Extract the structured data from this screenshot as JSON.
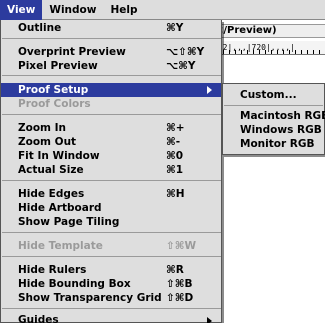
{
  "menubar": {
    "items": [
      {
        "label": "View",
        "active": true
      },
      {
        "label": "Window",
        "active": false
      },
      {
        "label": "Help",
        "active": false
      }
    ]
  },
  "document": {
    "title_fragment": "</Preview)",
    "ruler_text": "|52|,,,|720|,,,,|"
  },
  "view_menu": {
    "items": [
      {
        "label": "Outline",
        "shortcut": "⌘Y"
      },
      {
        "label": "Overprint Preview",
        "shortcut": "⌥⇧⌘Y"
      },
      {
        "label": "Pixel Preview",
        "shortcut": "⌥⌘Y"
      },
      {
        "label": "Proof Setup"
      },
      {
        "label": "Proof Colors"
      },
      {
        "label": "Zoom In",
        "shortcut": "⌘+"
      },
      {
        "label": "Zoom Out",
        "shortcut": "⌘-"
      },
      {
        "label": "Fit In Window",
        "shortcut": "⌘0"
      },
      {
        "label": "Actual Size",
        "shortcut": "⌘1"
      },
      {
        "label": "Hide Edges",
        "shortcut": "⌘H"
      },
      {
        "label": "Hide Artboard"
      },
      {
        "label": "Show Page Tiling"
      },
      {
        "label": "Hide Template",
        "shortcut": "⇧⌘W"
      },
      {
        "label": "Hide Rulers",
        "shortcut": "⌘R"
      },
      {
        "label": "Hide Bounding Box",
        "shortcut": "⇧⌘B"
      },
      {
        "label": "Show Transparency Grid",
        "shortcut": "⇧⌘D"
      },
      {
        "label": "Guides"
      }
    ]
  },
  "proof_setup_submenu": {
    "items": [
      {
        "label": "Custom..."
      },
      {
        "label": "Macintosh RGB"
      },
      {
        "label": "Windows RGB"
      },
      {
        "label": "Monitor RGB"
      }
    ]
  },
  "colors": {
    "highlight": "#2c3b9e",
    "menu_bg": "#dedede",
    "disabled_text": "#9a9a9a"
  }
}
